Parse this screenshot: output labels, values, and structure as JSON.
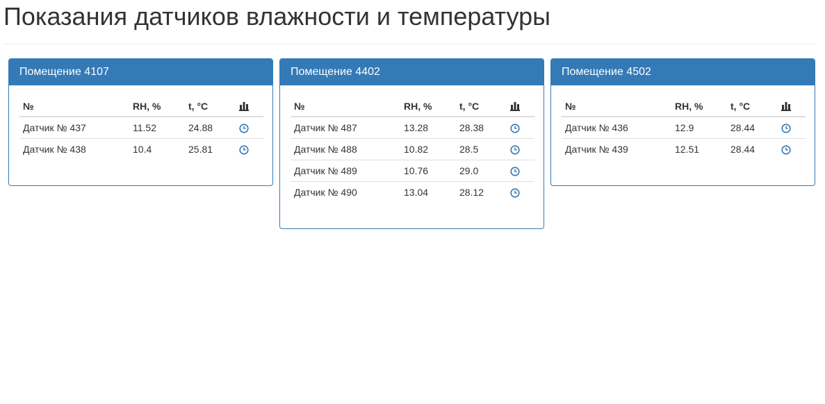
{
  "page": {
    "title": "Показания датчиков влажности и температуры"
  },
  "table_headers": {
    "number": "№",
    "rh": "RH, %",
    "temp": "t, °C",
    "chart_icon": "bar-chart-icon"
  },
  "row_icon": "clock-icon",
  "colors": {
    "accent": "#337ab7",
    "text": "#333333",
    "border": "#dddddd"
  },
  "rooms": [
    {
      "title": "Помещение 4107",
      "sensors": [
        {
          "name": "Датчик № 437",
          "rh": "11.52",
          "t": "24.88"
        },
        {
          "name": "Датчик № 438",
          "rh": "10.4",
          "t": "25.81"
        }
      ]
    },
    {
      "title": "Помещение 4402",
      "sensors": [
        {
          "name": "Датчик № 487",
          "rh": "13.28",
          "t": "28.38"
        },
        {
          "name": "Датчик № 488",
          "rh": "10.82",
          "t": "28.5"
        },
        {
          "name": "Датчик № 489",
          "rh": "10.76",
          "t": "29.0"
        },
        {
          "name": "Датчик № 490",
          "rh": "13.04",
          "t": "28.12"
        }
      ]
    },
    {
      "title": "Помещение 4502",
      "sensors": [
        {
          "name": "Датчик № 436",
          "rh": "12.9",
          "t": "28.44"
        },
        {
          "name": "Датчик № 439",
          "rh": "12.51",
          "t": "28.44"
        }
      ]
    }
  ]
}
